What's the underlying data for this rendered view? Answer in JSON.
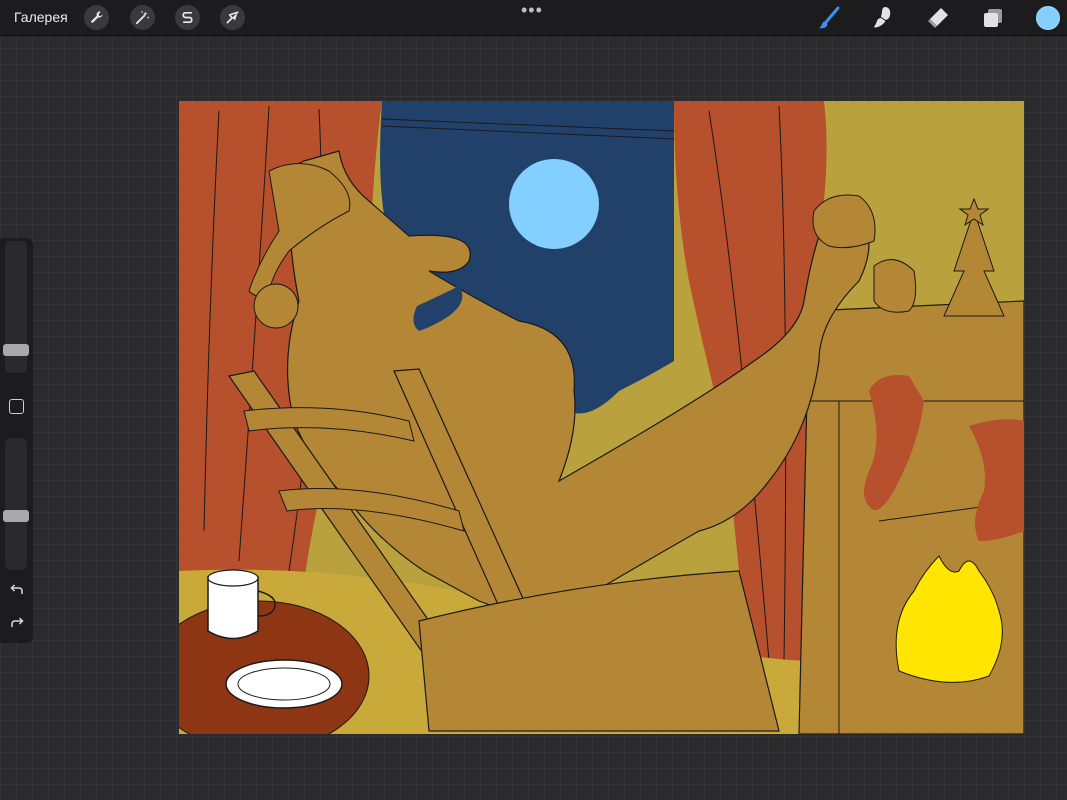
{
  "topbar": {
    "gallery_label": "Галерея",
    "left_tools": [
      {
        "name": "actions",
        "icon": "wrench-icon"
      },
      {
        "name": "adjustments",
        "icon": "magic-wand-icon"
      },
      {
        "name": "selection",
        "icon": "selection-s-icon"
      },
      {
        "name": "transform",
        "icon": "arrow-cursor-icon"
      }
    ],
    "more_label": "•••",
    "right_tools": [
      {
        "name": "brush",
        "icon": "brush-icon",
        "active": true
      },
      {
        "name": "smudge",
        "icon": "smudge-icon"
      },
      {
        "name": "eraser",
        "icon": "eraser-icon"
      },
      {
        "name": "layers",
        "icon": "layers-icon"
      }
    ],
    "current_color": "#83cfff"
  },
  "sidebar": {
    "brush_size": 0.14,
    "opacity": 0.4,
    "undo_icon": "undo-icon",
    "redo_icon": "redo-icon"
  },
  "artwork": {
    "palette": {
      "wall": "#b9a23e",
      "curtain": "#b7502c",
      "night_sky": "#22416a",
      "moon": "#83cfff",
      "figure": "#b48737",
      "table": "#8e3514",
      "fire": "#ffe500",
      "cup": "#ffffff"
    }
  }
}
